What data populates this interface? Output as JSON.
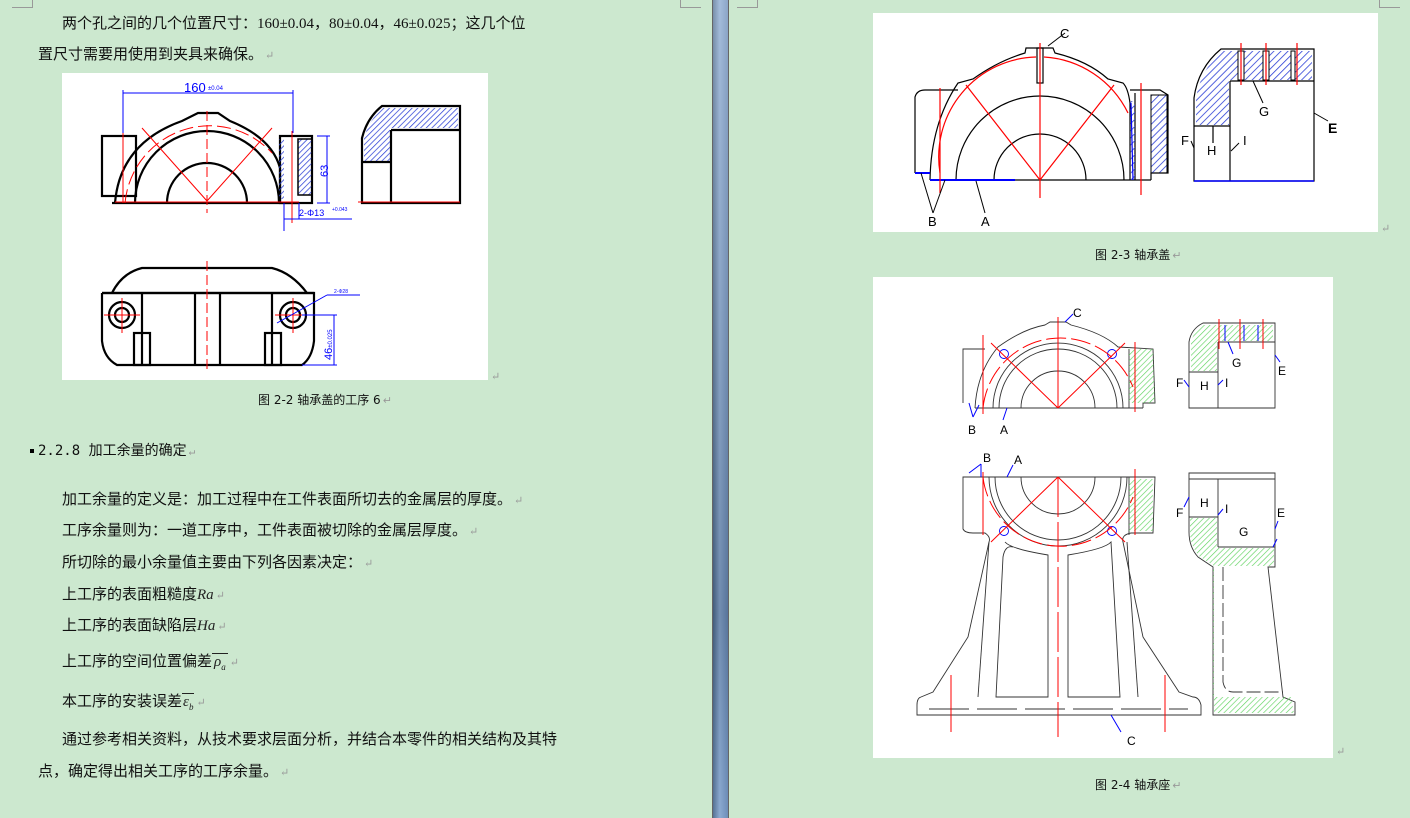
{
  "left_page": {
    "intro_line1": "两个孔之间的几个位置尺寸：160±0.04，80±0.04，46±0.025；这几个位",
    "intro_line2": "置尺寸需要用使用到夹具来确保。",
    "figure_2_2": {
      "caption": "图 2-2 轴承盖的工序 6",
      "dim_160": "160",
      "dim_160_tol": "±0.04",
      "dim_63": "63",
      "dim_hole": "2-Φ13",
      "dim_hole_tol": "+0.043",
      "dim_hole2": "2-Φ28",
      "dim_46": "46",
      "dim_46_tol": "±0.025"
    },
    "section_heading": "2.2.8 加工余量的确定",
    "paragraphs": [
      "加工余量的定义是：加工过程中在工件表面所切去的金属层的厚度。",
      "工序余量则为：一道工序中，工件表面被切除的金属层厚度。",
      "所切除的最小余量值主要由下列各因素决定："
    ],
    "factors": [
      {
        "text": "上工序的表面粗糙度",
        "symbol": "Ra"
      },
      {
        "text": "上工序的表面缺陷层",
        "symbol": "Ha"
      },
      {
        "text": "上工序的空间位置偏差",
        "symbol": "ρ",
        "sub": "a"
      },
      {
        "text": "本工序的安装误差",
        "symbol": "ε",
        "sub": "b"
      }
    ],
    "conclusion_line1": "通过参考相关资料，从技术要求层面分析，并结合本零件的相关结构及其特",
    "conclusion_line2": "点，确定得出相关工序的工序余量。"
  },
  "right_page": {
    "figure_2_3": {
      "caption": "图 2-3 轴承盖",
      "labels": {
        "A": "A",
        "B": "B",
        "C": "C",
        "E": "E",
        "F": "F",
        "G": "G",
        "H": "H",
        "I": "I"
      }
    },
    "figure_2_4": {
      "caption": "图 2-4 轴承座",
      "labels": {
        "A": "A",
        "B": "B",
        "C": "C",
        "E": "E",
        "F": "F",
        "G": "G",
        "H": "H",
        "I": "I"
      }
    }
  },
  "paragraph_mark": "↵",
  "colors": {
    "background": "#cce8cf",
    "drawing_red": "#ff0000",
    "drawing_blue": "#0000ff",
    "hatch_blue": "#2b3fd6",
    "hatch_green": "#5fd35f"
  }
}
